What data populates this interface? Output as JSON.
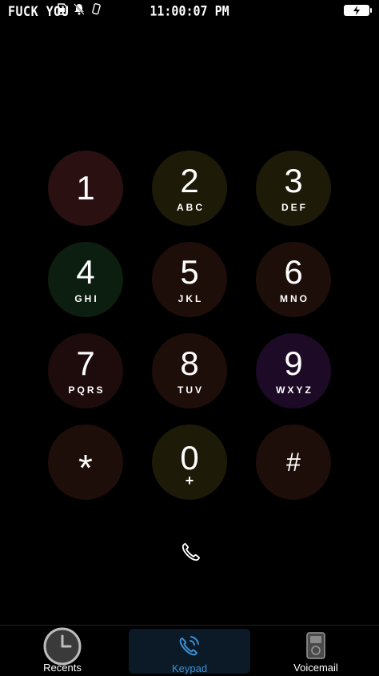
{
  "status_bar": {
    "carrier": "FUCK YOU",
    "time": "11:00:07 PM",
    "icons": [
      "sim-card-icon",
      "notification-bell-icon",
      "phone-rotate-icon"
    ],
    "battery": "charging"
  },
  "keypad": {
    "keys": [
      {
        "digit": "1",
        "letters": "",
        "color": "#2a1010"
      },
      {
        "digit": "2",
        "letters": "ABC",
        "color": "#1e1a08"
      },
      {
        "digit": "3",
        "letters": "DEF",
        "color": "#1e1a08"
      },
      {
        "digit": "4",
        "letters": "GHI",
        "color": "#0c1e10"
      },
      {
        "digit": "5",
        "letters": "JKL",
        "color": "#1e0e0a"
      },
      {
        "digit": "6",
        "letters": "MNO",
        "color": "#1e0e0a"
      },
      {
        "digit": "7",
        "letters": "PQRS",
        "color": "#1e0c0c"
      },
      {
        "digit": "8",
        "letters": "TUV",
        "color": "#1e0e0a"
      },
      {
        "digit": "9",
        "letters": "WXYZ",
        "color": "#1c0a26"
      },
      {
        "digit": "*",
        "letters": "",
        "color": "#1e0e0a"
      },
      {
        "digit": "0",
        "letters": "+",
        "color": "#1e1a08"
      },
      {
        "digit": "#",
        "letters": "",
        "color": "#1e0e0a"
      }
    ],
    "call_icon": "phone-handset-icon"
  },
  "tab_bar": {
    "tabs": [
      {
        "label": "Recents",
        "icon": "clock-icon",
        "selected": false
      },
      {
        "label": "Keypad",
        "icon": "phone-wave-icon",
        "selected": true
      },
      {
        "label": "Voicemail",
        "icon": "voicemail-device-icon",
        "selected": false
      }
    ],
    "active_color": "#3a8fd4",
    "inactive_color": "#ffffff"
  }
}
